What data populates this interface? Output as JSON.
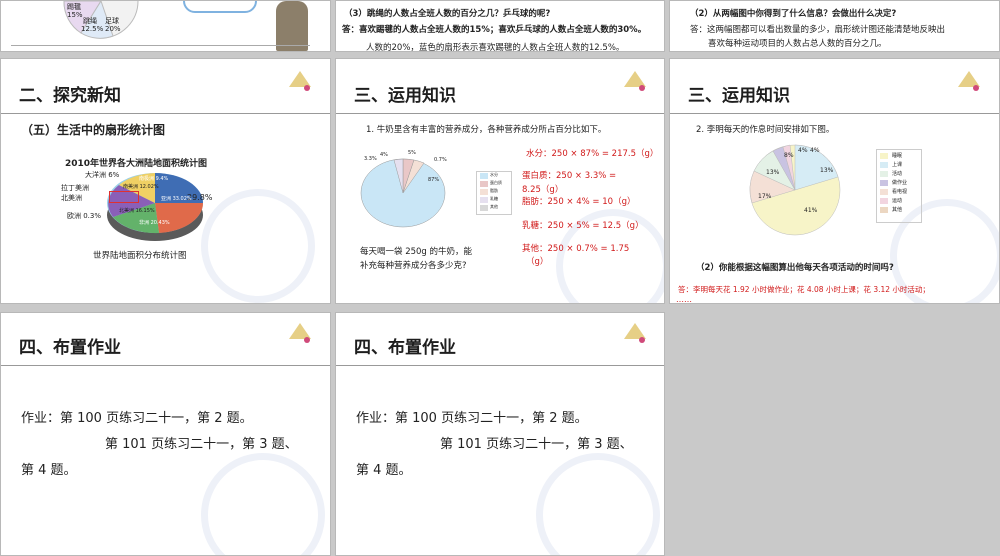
{
  "top_row": {
    "s1": {
      "label_a": "踢毽",
      "label_a_pct": "15%",
      "label_b": "跳绳",
      "label_b_pct": "12.5%",
      "label_c": "足球",
      "label_c_pct": "20%"
    },
    "s2": {
      "line1": "（3）跳绳的人数占全班人数的百分之几？乒乓球的呢?",
      "line2": "答：喜欢踢毽的人数占全班人数的15%；喜欢乒乓球的人数占全班人数的30%。",
      "line3": "人数的20%，蓝色的扇形表示喜欢踢毽的人数占全班人数的12.5%。"
    },
    "s3": {
      "line1": "（2）从两幅图中你得到了什么信息？会做出什么决定?",
      "line2": "答：这两幅图都可以看出数量的多少，扇形统计图还能清楚地反映出",
      "line3": "喜欢每种运动项目的人数占总人数的百分之几。"
    }
  },
  "slide4": {
    "title": "二、探究新知",
    "subtitle": "（五）生活中的扇形统计图",
    "chart_title": "2010年世界各大洲陆地面积统计图",
    "caption": "世界陆地面积分布统计图",
    "labels": [
      "大洋洲 6%",
      "拉丁美洲",
      "北美洲",
      "欧洲 0.3%",
      "29.8%",
      "南极洲 9.4%",
      "亚洲 33.02%",
      "非洲 20.43%",
      "北美洲 16.15%",
      "南美洲 12.02%"
    ]
  },
  "slide5": {
    "title": "三、运用知识",
    "problem": "1. 牛奶里含有丰富的营养成分，各种营养成分所占百分比如下。",
    "question_line1": "每天喝一袋 250g 的牛奶，能",
    "question_line2": "补充每种营养成分各多少克?",
    "pie_labels": [
      "3.3%",
      "4%",
      "5%",
      "0.7%",
      "87%"
    ],
    "legend": [
      "水分",
      "蛋白质",
      "脂肪",
      "乳糖",
      "其他"
    ],
    "answers": [
      "水分：250 × 87% = 217.5（g）",
      "蛋白质：250 × 3.3% =",
      "8.25（g）",
      "脂肪：250 × 4% = 10（g）",
      "乳糖：250 × 5% = 12.5（g）",
      "其他：250 × 0.7% = 1.75",
      "（g）"
    ]
  },
  "slide6": {
    "title": "三、运用知识",
    "problem": "2. 李明每天的作息时间安排如下图。",
    "pie_labels": [
      "8%",
      "4%",
      "4%",
      "13%",
      "13%",
      "17%",
      "41%"
    ],
    "legend": [
      "睡眠",
      "上课",
      "活动",
      "做作业",
      "看电视",
      "运动",
      "其他"
    ],
    "question": "（2）你能根据这幅图算出他每天各项活动的时间吗?",
    "answer": "答：李明每天花 1.92 小时做作业；花 4.08 小时上课；花 3.12 小时活动；",
    "dots": "……"
  },
  "slide7": {
    "title": "四、布置作业",
    "line1": "作业：第 100 页练习二十一，第 2 题。",
    "line2": "第 101 页练习二十一，第 3 题、",
    "line3": "第 4 题。"
  },
  "slide8": {
    "title": "四、布置作业",
    "line1": "作业：第 100 页练习二十一，第 2 题。",
    "line2": "第 101 页练习二十一，第 3 题、",
    "line3": "第 4 题。"
  }
}
